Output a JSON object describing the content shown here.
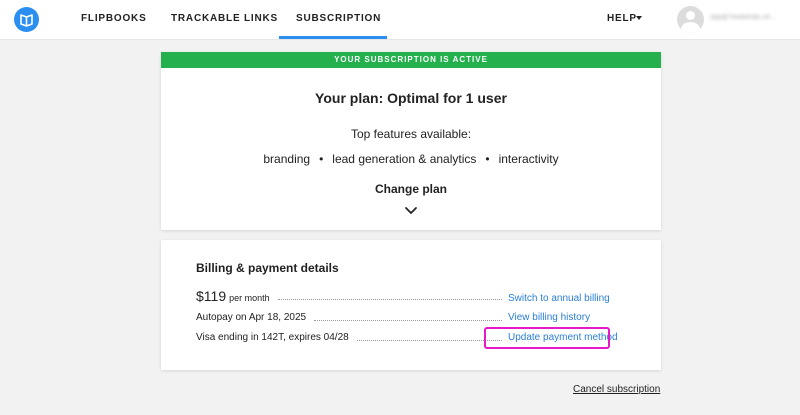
{
  "nav": {
    "items": [
      {
        "label": "FLIPBOOKS"
      },
      {
        "label": "TRACKABLE LINKS"
      },
      {
        "label": "SUBSCRIPTION"
      }
    ],
    "help_label": "HELP",
    "user_name": "vpp@7ewb4ndz.c4..."
  },
  "plan": {
    "status_banner": "YOUR SUBSCRIPTION IS ACTIVE",
    "title": "Your plan: Optimal for 1 user",
    "features_title": "Top features available:",
    "features": [
      "branding",
      "lead generation & analytics",
      "interactivity"
    ],
    "separator": "•",
    "change_plan_label": "Change plan"
  },
  "billing": {
    "title": "Billing & payment details",
    "price": "$119",
    "price_period": "per month",
    "switch_link": "Switch to annual billing",
    "autopay_text": "Autopay on Apr 18, 2025",
    "history_link": "View billing history",
    "card_text": "Visa ending in 142T, expires 04/28",
    "update_link": "Update payment method"
  },
  "cancel_label": "Cancel subscription",
  "colors": {
    "accent": "#2a8ff0",
    "active_green": "#24b04c",
    "link_blue": "#2a7fd4",
    "highlight_magenta": "#e619c8"
  }
}
